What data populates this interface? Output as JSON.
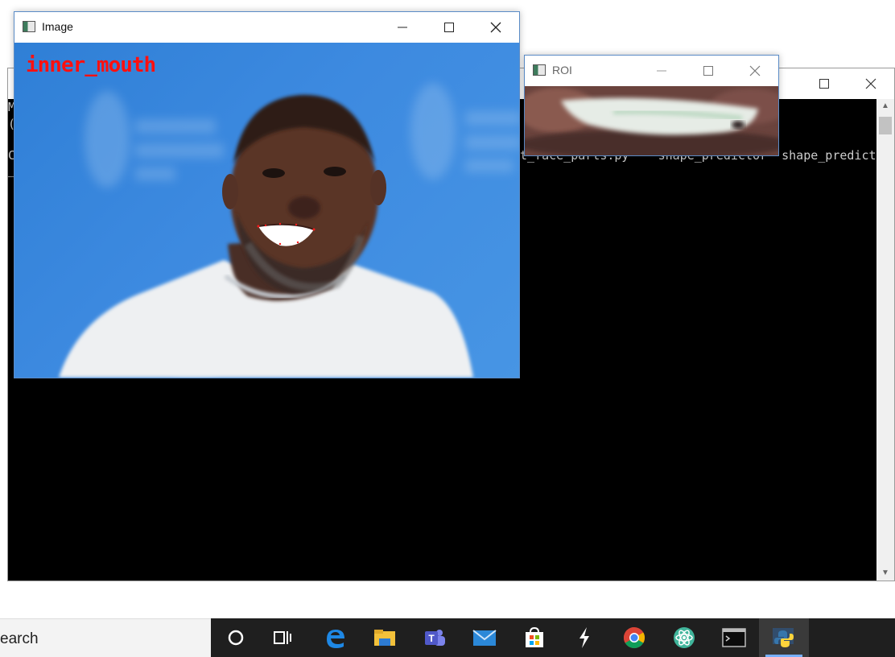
{
  "image_window": {
    "title": "Image",
    "overlay_label": "inner_mouth"
  },
  "roi_window": {
    "title": "ROI"
  },
  "console": {
    "line1": "M",
    "line2": "(",
    "line3_prefix": "C",
    "line3_visible": "t_face_parts.py    shape_predictor  shape_predictor"
  },
  "taskbar": {
    "search_text": "earch",
    "icons": [
      "cortana-icon",
      "task-view-icon",
      "edge-icon",
      "file-explorer-icon",
      "teams-icon",
      "mail-icon",
      "store-icon",
      "app-icon",
      "chrome-icon",
      "atom-icon",
      "terminal-icon",
      "python-icon"
    ]
  },
  "colors": {
    "overlay_red": "#ff1010",
    "photo_bg": "#3d8ae0",
    "taskbar_bg": "#1f1f1f"
  }
}
